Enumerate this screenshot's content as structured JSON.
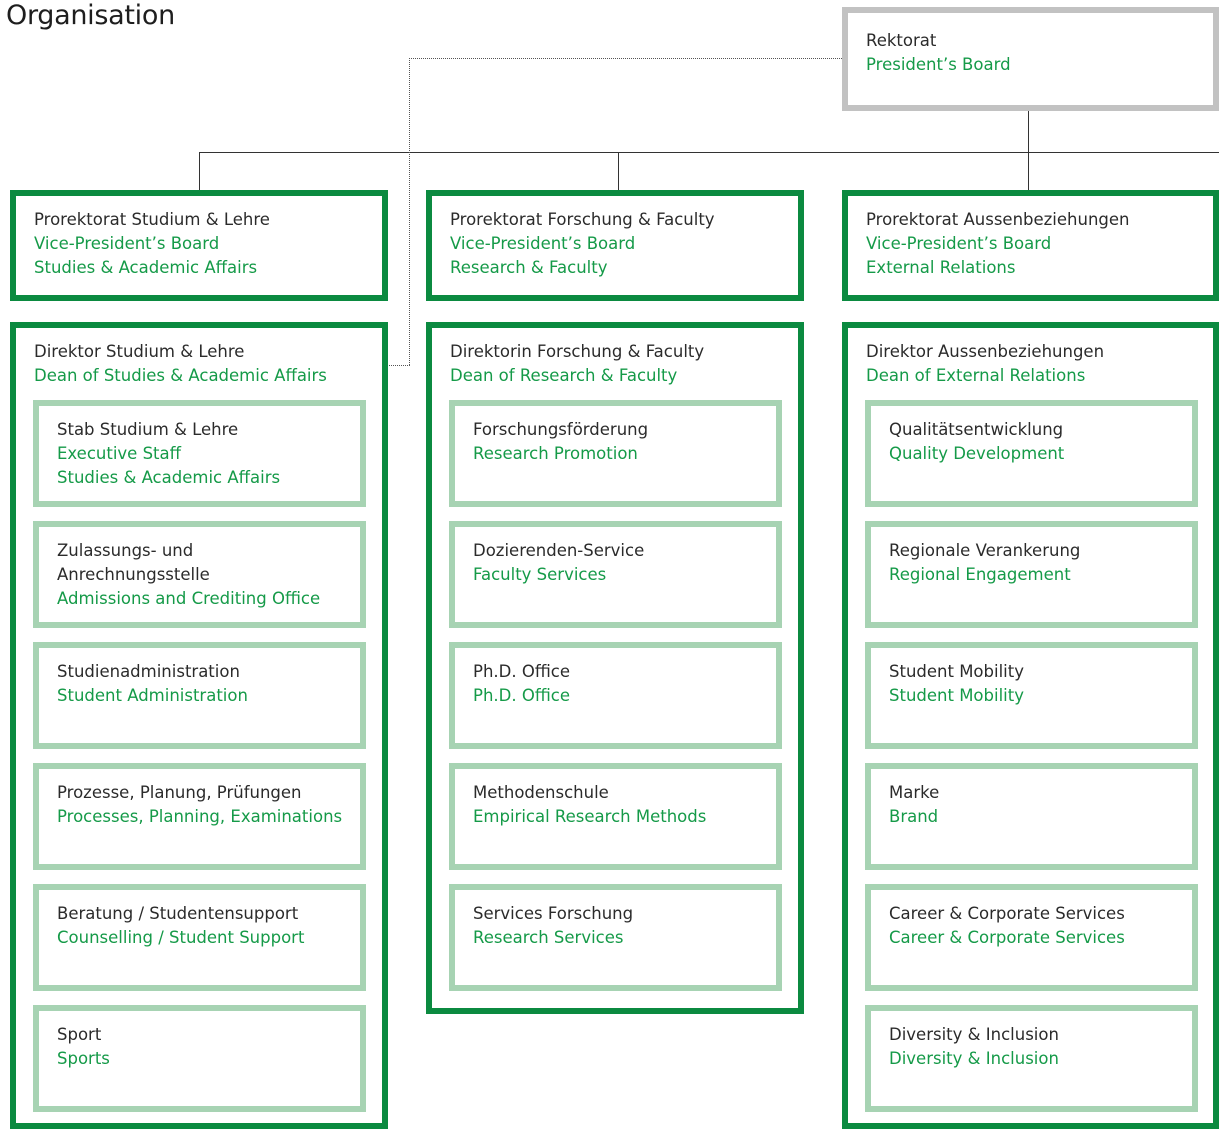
{
  "title": "Organisation",
  "top": {
    "de": "Rektorat",
    "en": "President’s Board"
  },
  "columns": [
    {
      "head": {
        "de": "Prorektorat Studium & Lehre",
        "en1": "Vice-President’s Board",
        "en2": "Studies & Academic Affairs"
      },
      "director": {
        "de": "Direktor Studium & Lehre",
        "en": "Dean of Studies & Academic Affairs"
      },
      "units": [
        {
          "de": "Stab Studium & Lehre",
          "en1": "Executive Staff",
          "en2": "Studies & Academic Affairs"
        },
        {
          "de1": "Zulassungs- und",
          "de2": "Anrechnungsstelle",
          "en": "Admissions and Crediting Office"
        },
        {
          "de": "Studienadministration",
          "en": "Student Administration"
        },
        {
          "de": "Prozesse, Planung, Prüfungen",
          "en": "Processes, Planning, Examinations"
        },
        {
          "de": "Beratung / Studentensupport",
          "en": "Counselling / Student Support"
        },
        {
          "de": "Sport",
          "en": "Sports"
        }
      ]
    },
    {
      "head": {
        "de": "Prorektorat Forschung & Faculty",
        "en1": "Vice-President’s Board",
        "en2": "Research & Faculty"
      },
      "director": {
        "de": "Direktorin Forschung & Faculty",
        "en": "Dean of Research & Faculty"
      },
      "units": [
        {
          "de": "Forschungsförderung",
          "en": "Research Promotion"
        },
        {
          "de": "Dozierenden-Service",
          "en": "Faculty Services"
        },
        {
          "de": "Ph.D. Office",
          "en": "Ph.D. Office"
        },
        {
          "de": "Methodenschule",
          "en": "Empirical Research Methods"
        },
        {
          "de": "Services Forschung",
          "en": "Research Services"
        }
      ]
    },
    {
      "head": {
        "de": "Prorektorat Aussenbeziehungen",
        "en1": "Vice-President’s Board",
        "en2": "External Relations"
      },
      "director": {
        "de": "Direktor Aussenbeziehungen",
        "en": "Dean of External Relations"
      },
      "units": [
        {
          "de": "Qualitätsentwicklung",
          "en": "Quality Development"
        },
        {
          "de": "Regionale Verankerung",
          "en": "Regional Engagement"
        },
        {
          "de": "Student Mobility",
          "en": "Student Mobility"
        },
        {
          "de": "Marke",
          "en": "Brand"
        },
        {
          "de": "Career & Corporate Services",
          "en": "Career & Corporate Services"
        },
        {
          "de": "Diversity & Inclusion",
          "en": "Diversity & Inclusion"
        }
      ]
    }
  ]
}
